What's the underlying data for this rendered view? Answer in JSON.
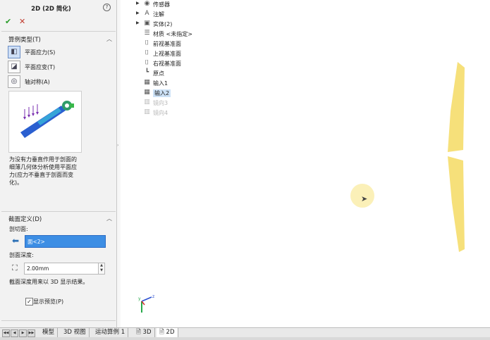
{
  "panel": {
    "title": "2D (2D 简化)",
    "help_label": "?",
    "ok_label": "✔",
    "cancel_label": "✕",
    "study_type": {
      "title": "算例类型(T)",
      "options": [
        {
          "label": "平面应力(S)",
          "icon": "plane-stress-icon",
          "selected": true
        },
        {
          "label": "平面应变(T)",
          "icon": "plane-strain-icon",
          "selected": false
        },
        {
          "label": "轴对称(A)",
          "icon": "axisymmetric-icon",
          "selected": false
        }
      ],
      "description": "为没有力垂直作用于剖面的细薄几何体分析使用平面应力(应力不垂直于剖面而变化)。"
    },
    "section": {
      "title": "截面定义(D)",
      "plane_label": "剖切面:",
      "plane_value": "面<2>",
      "depth_label": "剖面深度:",
      "depth_value": "2.00mm",
      "note": "截面深度用来以 3D 显示结果。",
      "preview_label": "显示预览(P)",
      "preview_checked": true
    }
  },
  "tree": {
    "items": [
      {
        "label": "传感器",
        "icon": "sensor-icon",
        "expandable": true,
        "state": "normal"
      },
      {
        "label": "注解",
        "icon": "annotation-icon",
        "expandable": true,
        "state": "normal"
      },
      {
        "label": "实体(2)",
        "icon": "solid-bodies-icon",
        "expandable": true,
        "state": "normal"
      },
      {
        "label": "材质 <未指定>",
        "icon": "material-icon",
        "expandable": false,
        "state": "normal"
      },
      {
        "label": "前视基准面",
        "icon": "plane-icon",
        "expandable": false,
        "state": "normal"
      },
      {
        "label": "上视基准面",
        "icon": "plane-icon",
        "expandable": false,
        "state": "normal"
      },
      {
        "label": "右视基准面",
        "icon": "plane-icon",
        "expandable": false,
        "state": "normal"
      },
      {
        "label": "原点",
        "icon": "origin-icon",
        "expandable": false,
        "state": "normal"
      },
      {
        "label": "输入1",
        "icon": "import-icon",
        "expandable": false,
        "state": "normal"
      },
      {
        "label": "输入2",
        "icon": "import-icon",
        "expandable": false,
        "state": "selected"
      },
      {
        "label": "镜向3",
        "icon": "mirror-icon",
        "expandable": false,
        "state": "disabled"
      },
      {
        "label": "镜向4",
        "icon": "mirror-icon",
        "expandable": false,
        "state": "disabled"
      }
    ]
  },
  "triad": {
    "z_label": "z",
    "y_label": "y"
  },
  "tabs": [
    {
      "label": "模型",
      "active": false
    },
    {
      "label": "3D 视图",
      "active": false
    },
    {
      "label": "运动算例 1",
      "active": false
    },
    {
      "label": "3D",
      "active": false
    },
    {
      "label": "2D",
      "active": true
    }
  ],
  "colors": {
    "shape_fill": "#f6e07a",
    "selection_blue": "#3d8ee4",
    "cursor_highlight": "#fbeeb0"
  }
}
